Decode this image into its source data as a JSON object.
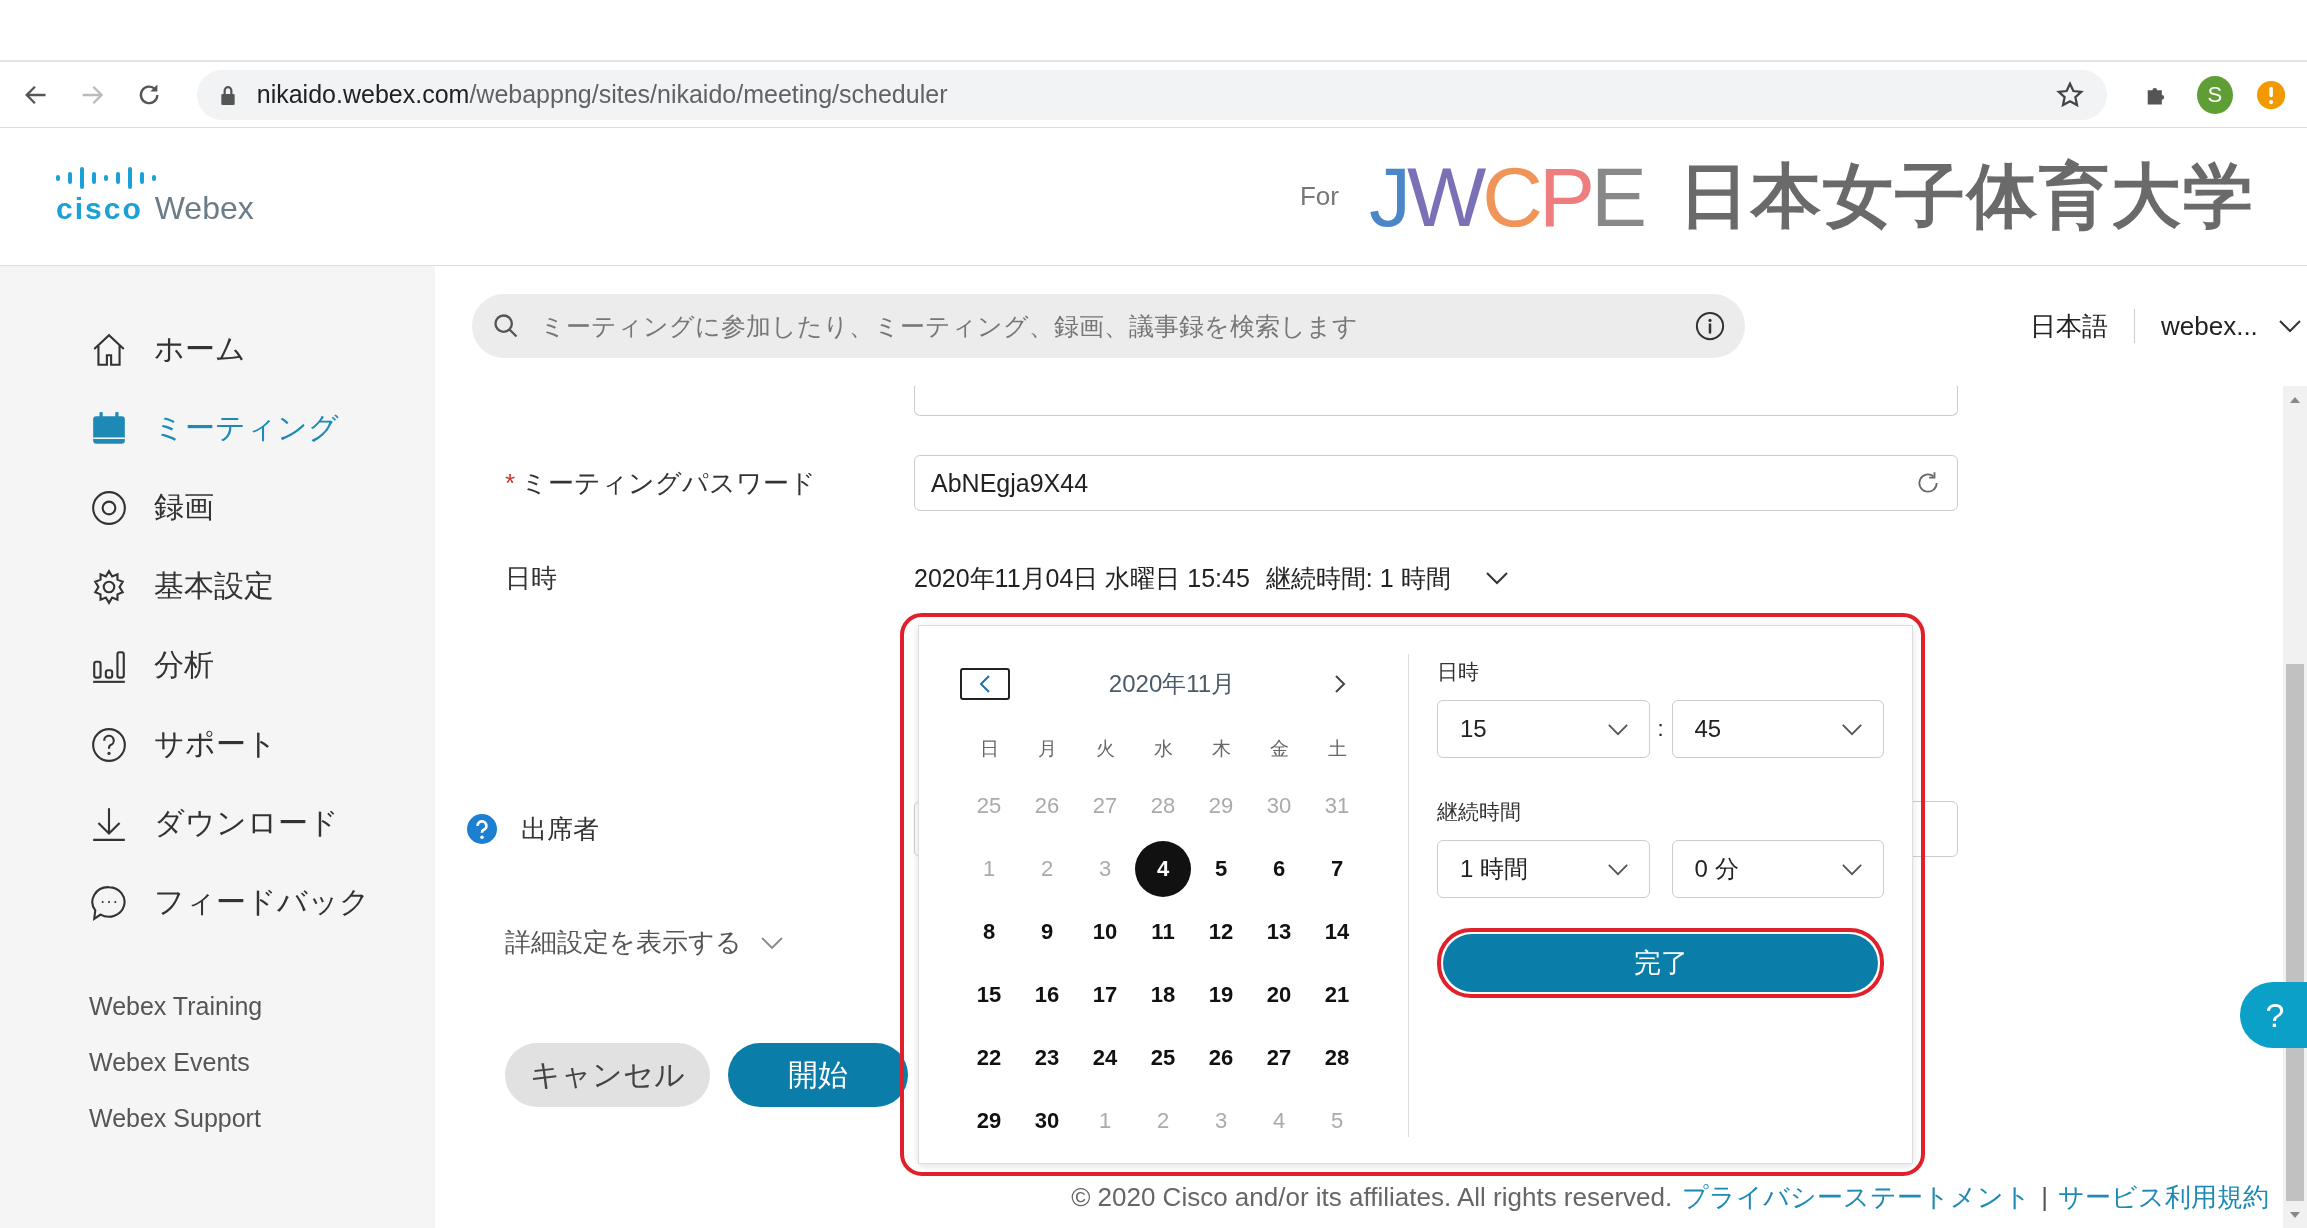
{
  "browser": {
    "url_host": "nikaido.webex.com",
    "url_path": "/webappng/sites/nikaido/meeting/scheduler",
    "profile_letter": "S"
  },
  "header": {
    "cisco": "cisco",
    "product": "Webex",
    "for": "For",
    "jwcpe": "JWCPE",
    "university": "日本女子体育大学"
  },
  "sidebar": {
    "items": [
      {
        "kind": "home",
        "label": "ホーム",
        "selected": false
      },
      {
        "kind": "meetings",
        "label": "ミーティング",
        "selected": true
      },
      {
        "kind": "recordings",
        "label": "録画",
        "selected": false
      },
      {
        "kind": "settings",
        "label": "基本設定",
        "selected": false
      },
      {
        "kind": "analytics",
        "label": "分析",
        "selected": false
      },
      {
        "kind": "support",
        "label": "サポート",
        "selected": false
      },
      {
        "kind": "download",
        "label": "ダウンロード",
        "selected": false
      },
      {
        "kind": "feedback",
        "label": "フィードバック",
        "selected": false
      }
    ],
    "links": [
      "Webex Training",
      "Webex Events",
      "Webex Support"
    ]
  },
  "topbar": {
    "search": {
      "placeholder": "ミーティングに参加したり、ミーティング、録画、議事録を検索します"
    },
    "language": "日本語",
    "account": "webex..."
  },
  "form": {
    "password": {
      "label": "ミーティングパスワード",
      "required_mark": "*",
      "value": "AbNEgja9X44"
    },
    "datetime": {
      "label": "日時",
      "date": "2020年11月04日 水曜日 15:45",
      "duration": "継続時間: 1 時間",
      "expanded": true
    },
    "attendees": {
      "label": "出席者"
    },
    "advanced": "詳細設定を表示する",
    "buttons": {
      "cancel": "キャンセル",
      "start": "開始"
    }
  },
  "picker": {
    "outlined": true,
    "month": "2020年11月",
    "weekdays": [
      "日",
      "月",
      "火",
      "水",
      "木",
      "金",
      "土"
    ],
    "days": [
      {
        "label": "25",
        "in_month": false,
        "selected": false
      },
      {
        "label": "26",
        "in_month": false,
        "selected": false
      },
      {
        "label": "27",
        "in_month": false,
        "selected": false
      },
      {
        "label": "28",
        "in_month": false,
        "selected": false
      },
      {
        "label": "29",
        "in_month": false,
        "selected": false
      },
      {
        "label": "30",
        "in_month": false,
        "selected": false
      },
      {
        "label": "31",
        "in_month": false,
        "selected": false
      },
      {
        "label": "1",
        "in_month": false,
        "selected": false
      },
      {
        "label": "2",
        "in_month": false,
        "selected": false
      },
      {
        "label": "3",
        "in_month": false,
        "selected": false
      },
      {
        "label": "4",
        "in_month": true,
        "selected": true
      },
      {
        "label": "5",
        "in_month": true,
        "selected": false
      },
      {
        "label": "6",
        "in_month": true,
        "selected": false
      },
      {
        "label": "7",
        "in_month": true,
        "selected": false
      },
      {
        "label": "8",
        "in_month": true,
        "selected": false
      },
      {
        "label": "9",
        "in_month": true,
        "selected": false
      },
      {
        "label": "10",
        "in_month": true,
        "selected": false
      },
      {
        "label": "11",
        "in_month": true,
        "selected": false
      },
      {
        "label": "12",
        "in_month": true,
        "selected": false
      },
      {
        "label": "13",
        "in_month": true,
        "selected": false
      },
      {
        "label": "14",
        "in_month": true,
        "selected": false
      },
      {
        "label": "15",
        "in_month": true,
        "selected": false
      },
      {
        "label": "16",
        "in_month": true,
        "selected": false
      },
      {
        "label": "17",
        "in_month": true,
        "selected": false
      },
      {
        "label": "18",
        "in_month": true,
        "selected": false
      },
      {
        "label": "19",
        "in_month": true,
        "selected": false
      },
      {
        "label": "20",
        "in_month": true,
        "selected": false
      },
      {
        "label": "21",
        "in_month": true,
        "selected": false
      },
      {
        "label": "22",
        "in_month": true,
        "selected": false
      },
      {
        "label": "23",
        "in_month": true,
        "selected": false
      },
      {
        "label": "24",
        "in_month": true,
        "selected": false
      },
      {
        "label": "25",
        "in_month": true,
        "selected": false
      },
      {
        "label": "26",
        "in_month": true,
        "selected": false
      },
      {
        "label": "27",
        "in_month": true,
        "selected": false
      },
      {
        "label": "28",
        "in_month": true,
        "selected": false
      },
      {
        "label": "29",
        "in_month": true,
        "selected": false
      },
      {
        "label": "30",
        "in_month": true,
        "selected": false
      },
      {
        "label": "1",
        "in_month": false,
        "selected": false
      },
      {
        "label": "2",
        "in_month": false,
        "selected": false
      },
      {
        "label": "3",
        "in_month": false,
        "selected": false
      },
      {
        "label": "4",
        "in_month": false,
        "selected": false
      },
      {
        "label": "5",
        "in_month": false,
        "selected": false
      }
    ],
    "time_label": "日時",
    "hour": "15",
    "separator": ":",
    "minute": "45",
    "duration_label": "継続時間",
    "duration_hours": "1 時間",
    "duration_minutes": "0 分",
    "done": {
      "label": "完了",
      "outlined": true
    }
  },
  "help_button": "?",
  "footer": {
    "copyright": "© 2020 Cisco and/or its affiliates. All rights reserved.",
    "links": [
      "プライバシーステートメント",
      "サービス利用規約"
    ],
    "separator": "|"
  }
}
